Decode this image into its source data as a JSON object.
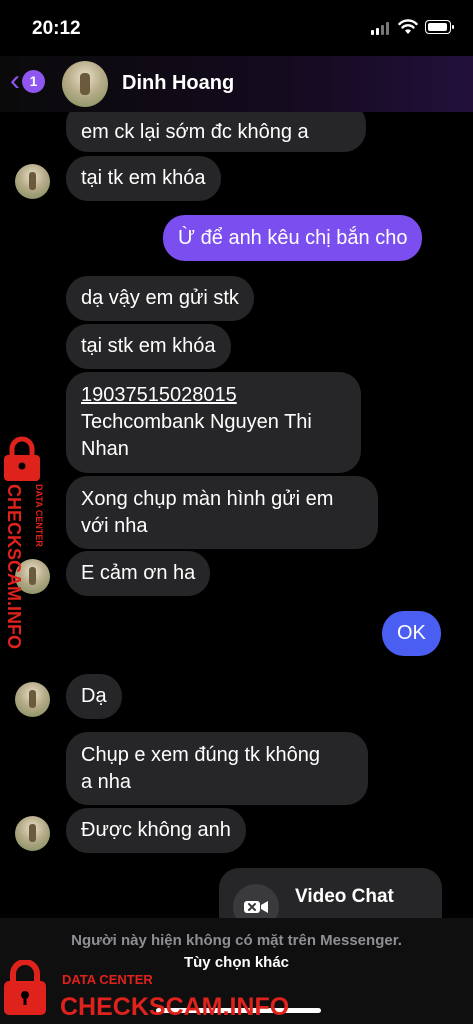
{
  "status_bar": {
    "time": "20:12"
  },
  "header": {
    "back_badge": "1",
    "contact_name": "Dinh Hoang"
  },
  "messages": [
    {
      "text": "em ck lại sớm đc không a"
    },
    {
      "text": "tại tk em khóa"
    },
    {
      "text": "Ừ để anh kêu chị bắn cho"
    },
    {
      "text": "dạ vậy em gửi stk"
    },
    {
      "text": "tại stk em khóa"
    },
    {
      "lines": [
        "19037515028015",
        "Techcombank Nguyen Thi",
        "Nhan"
      ]
    },
    {
      "lines": [
        "Xong chụp màn hình gửi em",
        "với nha"
      ]
    },
    {
      "text": "E cảm ơn ha"
    },
    {
      "text": "OK"
    },
    {
      "text": "Dạ"
    },
    {
      "lines": [
        "Chụp e xem đúng tk không",
        "a nha"
      ]
    },
    {
      "text": "Được không anh"
    }
  ],
  "video_chat": {
    "title": "Video Chat"
  },
  "footer": {
    "notice": "Người này hiện không có mặt trên Messenger.",
    "more_options": "Tùy chọn khác"
  },
  "watermark": {
    "label": "DATA CENTER",
    "brand": "CHECKSCAM.INFO"
  },
  "colors": {
    "accent_purple": "#7b4ef0",
    "accent_blue": "#4b5ef2",
    "incoming_bubble": "#262628",
    "watermark_red": "#e0221c"
  }
}
